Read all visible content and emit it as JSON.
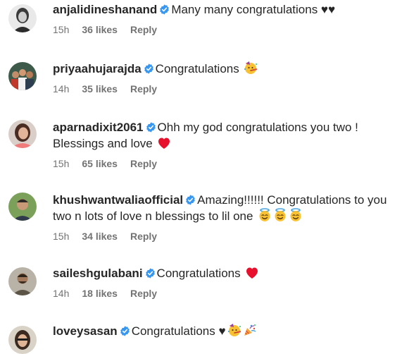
{
  "colors": {
    "verified_badge": "#3897f0",
    "meta_text": "#737373",
    "body_text": "#262626",
    "heart_red": "#e8112d"
  },
  "comments": [
    {
      "username": "anjalidineshanand",
      "verified": true,
      "text": "Many many congratulations ♥♥",
      "emojis": [],
      "time": "15h",
      "likes": "36 likes",
      "reply": "Reply"
    },
    {
      "username": "priyaahujarajda",
      "verified": true,
      "text": "Congratulations ",
      "emojis": [
        "partying-face-icon"
      ],
      "time": "14h",
      "likes": "35 likes",
      "reply": "Reply"
    },
    {
      "username": "aparnadixit2061",
      "verified": true,
      "text": "Ohh my god congratulations you two ! Blessings and love ",
      "emojis": [
        "red-heart-icon"
      ],
      "time": "15h",
      "likes": "65 likes",
      "reply": "Reply"
    },
    {
      "username": "khushwantwaliaofficial",
      "verified": true,
      "text": "Amazing!!!!!! Congratulations to you two n lots of love n blessings to lil one ",
      "emojis": [
        "smiling-face-with-halo-icon",
        "smiling-face-with-halo-icon",
        "smiling-face-with-halo-icon"
      ],
      "time": "15h",
      "likes": "34 likes",
      "reply": "Reply"
    },
    {
      "username": "saileshgulabani",
      "verified": true,
      "text": "Congratulations ",
      "emojis": [
        "red-heart-icon"
      ],
      "time": "14h",
      "likes": "18 likes",
      "reply": "Reply"
    },
    {
      "username": "loveysasan",
      "verified": true,
      "text": "Congratulations ♥",
      "emojis": [
        "partying-face-icon",
        "party-popper-icon"
      ],
      "time": "",
      "likes": "",
      "reply": ""
    }
  ]
}
